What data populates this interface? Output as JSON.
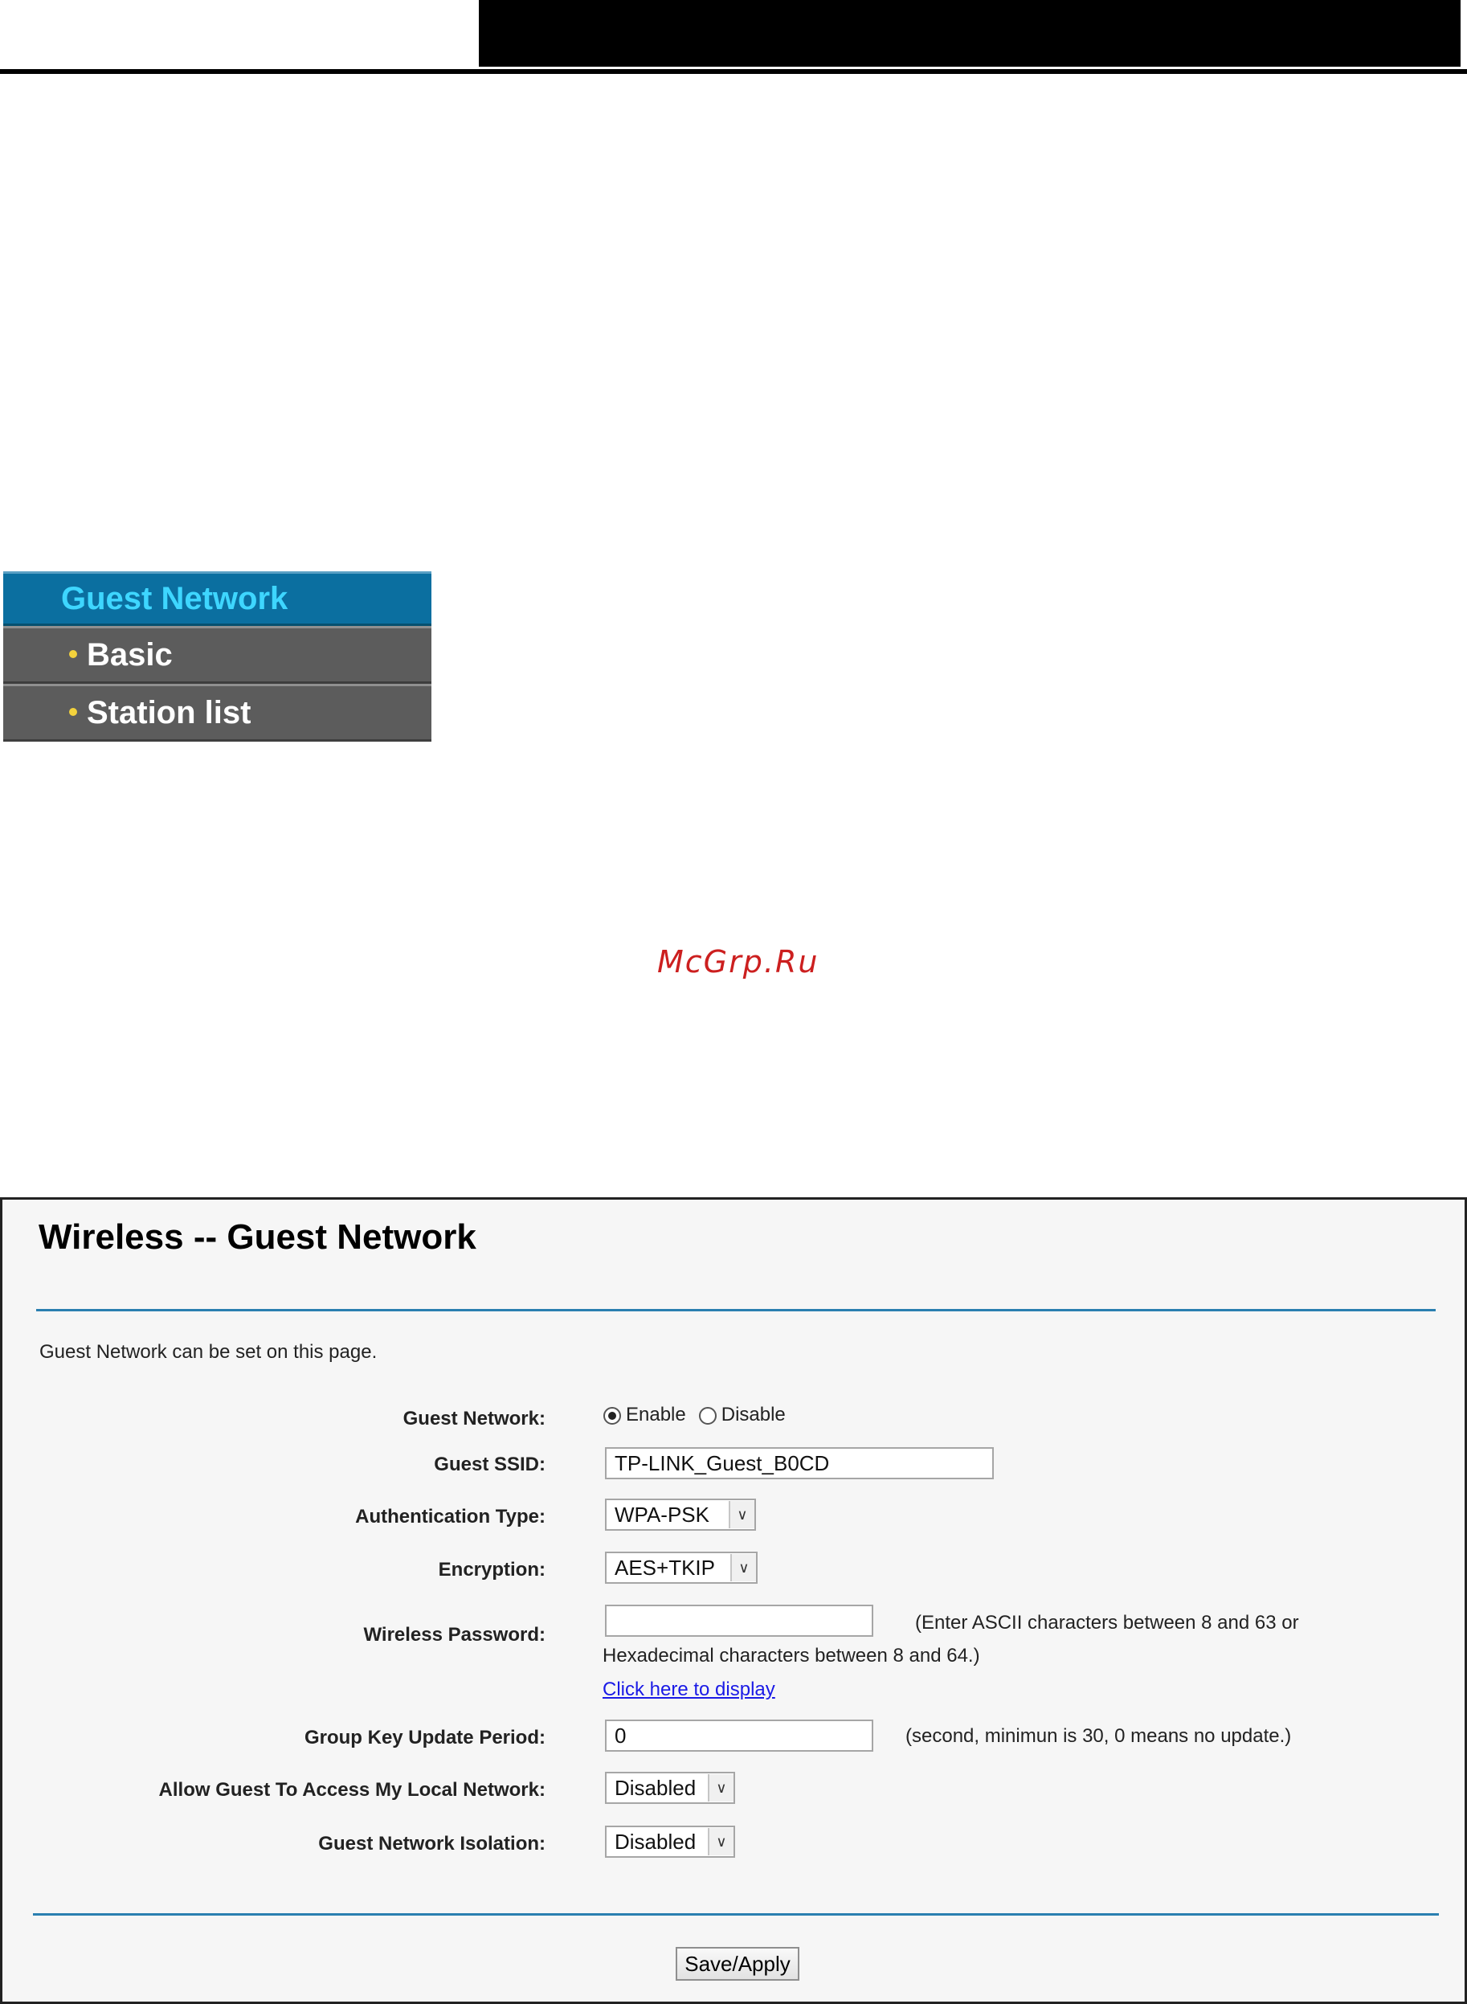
{
  "menu": {
    "header": "Guest Network",
    "items": [
      {
        "label": "Basic"
      },
      {
        "label": "Station list"
      }
    ]
  },
  "watermark": "McGrp.Ru",
  "panel": {
    "title": "Wireless -- Guest Network",
    "intro": "Guest Network can be set on this page.",
    "fields": {
      "guest_network": {
        "label": "Guest Network:",
        "options": [
          "Enable",
          "Disable"
        ],
        "selected": "Enable"
      },
      "guest_ssid": {
        "label": "Guest SSID:",
        "value": "TP-LINK_Guest_B0CD"
      },
      "auth_type": {
        "label": "Authentication Type:",
        "value": "WPA-PSK"
      },
      "encryption": {
        "label": "Encryption:",
        "value": "AES+TKIP"
      },
      "wireless_password": {
        "label": "Wireless Password:",
        "value": "",
        "hint_line1": "(Enter ASCII characters between 8 and 63 or",
        "hint_line2": "Hexadecimal characters between 8 and 64.)",
        "link": "Click here to display"
      },
      "group_key": {
        "label": "Group Key Update Period:",
        "value": "0",
        "hint": "(second, minimun is 30, 0 means no update.)"
      },
      "allow_guest": {
        "label": "Allow Guest To Access My Local Network:",
        "value": "Disabled"
      },
      "isolation": {
        "label": "Guest Network Isolation:",
        "value": "Disabled"
      }
    },
    "save_label": "Save/Apply"
  },
  "colors": {
    "menu_header_bg": "#0b6fa0",
    "menu_header_text": "#3ed6ff",
    "menu_item_bg": "#5c5c5c",
    "bullet": "#f3d23c",
    "rule": "#2a7fb0",
    "link": "#1a1ae6",
    "watermark": "#cc1f1f"
  },
  "icons": {
    "bullet": "bullet-icon",
    "dropdown": "chevron-down-icon"
  }
}
